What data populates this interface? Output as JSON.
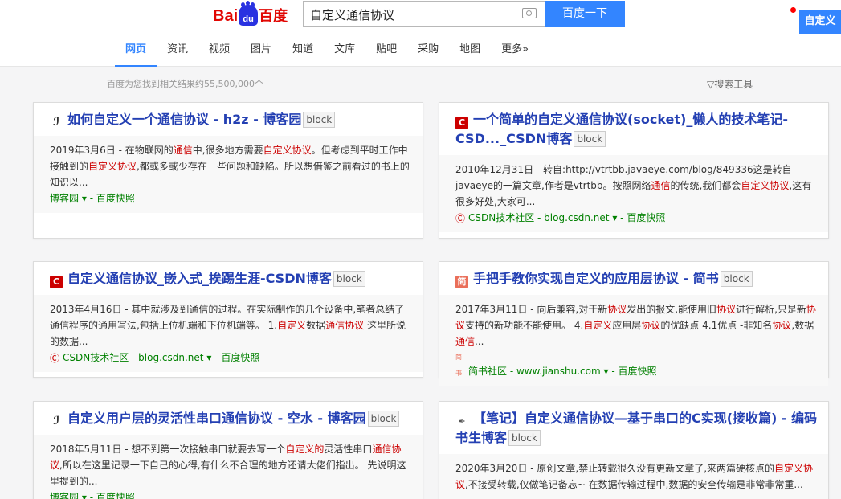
{
  "header": {
    "logo": {
      "left": "Bai",
      "paw": "du",
      "right": "百度"
    },
    "search_value": "自定义通信协议",
    "search_button": "百度一下",
    "custom_button": "自定义"
  },
  "nav": {
    "tabs": [
      "网页",
      "资讯",
      "视频",
      "图片",
      "知道",
      "文库",
      "贴吧",
      "采购",
      "地图",
      "更多»"
    ],
    "active": "网页"
  },
  "result_count": "百度为您找到相关结果约55,500,000个",
  "tools_label": "搜索工具",
  "block_label": "block",
  "snapshot_label": "百度快照",
  "results": [
    {
      "title": "如何自定义一个通信协议 - h2z - 博客园",
      "abstract": "2019年3月6日 - 在物联网的通信中,很多地方需要自定义协议。但考虑到平时工作中接触到的自定义协议,都或多或少存在一些问题和缺陷。所以想借鉴之前看过的书上的知识以...",
      "source": "博客园",
      "icon": "cnblogs-icon"
    },
    {
      "title": "一个简单的自定义通信协议(socket)_懒人的技术笔记-CSD..._CSDN博客",
      "abstract": "2010年12月31日 - 转自:http://vtrtbb.javaeye.com/blog/849336这是转自javaeye的一篇文章,作者是vtrtbb。按照网络通信的传统,我们都会自定义协议,这有很多好处,大家可...",
      "source": "CSDN技术社区 - blog.csdn.net",
      "icon": "csdn-icon"
    },
    {
      "title": "自定义通信协议_嵌入式_挨踢生涯-CSDN博客",
      "abstract": "2013年4月16日 - 其中就涉及到通信的过程。在实际制作的几个设备中,笔者总结了通信程序的通用写法,包括上位机端和下位机端等。 1.自定义数据通信协议 这里所说的数据...",
      "source": "CSDN技术社区 - blog.csdn.net",
      "icon": "csdn-icon"
    },
    {
      "title": "手把手教你实现自定义的应用层协议 - 简书",
      "abstract": "2017年3月11日 - 向后兼容,对于新协议发出的报文,能使用旧协议进行解析,只是新协议支持的新功能不能使用。 4.自定义应用层协议的优缺点 4.1优点 -非知名协议,数据通信...",
      "source": "简书社区 - www.jianshu.com",
      "icon": "jianshu-icon"
    },
    {
      "title": "自定义用户层的灵活性串口通信协议 - 空水 - 博客园",
      "abstract": "2018年5月11日 - 想不到第一次接触串口就要去写一个自定义的灵活性串口通信协议,所以在这里记录一下自己的心得,有什么不合理的地方还请大佬们指出。 先说明这里提到的...",
      "source": "博客园",
      "icon": "cnblogs-icon"
    },
    {
      "title": "【笔记】自定义通信协议—基于串口的C实现(接收篇) - 编码书生博客",
      "abstract": "2020年3月20日 - 原创文章,禁止转载很久没有更新文章了,来两篇硬核点的自定义协议,不接受转载,仅做笔记备忘~ 在数据传输过程中,数据的安全传输是非常非常重...",
      "source": "",
      "icon": "feather-icon"
    }
  ],
  "colors": {
    "link": "#2440b3",
    "accent": "#3385ff",
    "highlight": "#cc0000",
    "source": "#008000"
  }
}
